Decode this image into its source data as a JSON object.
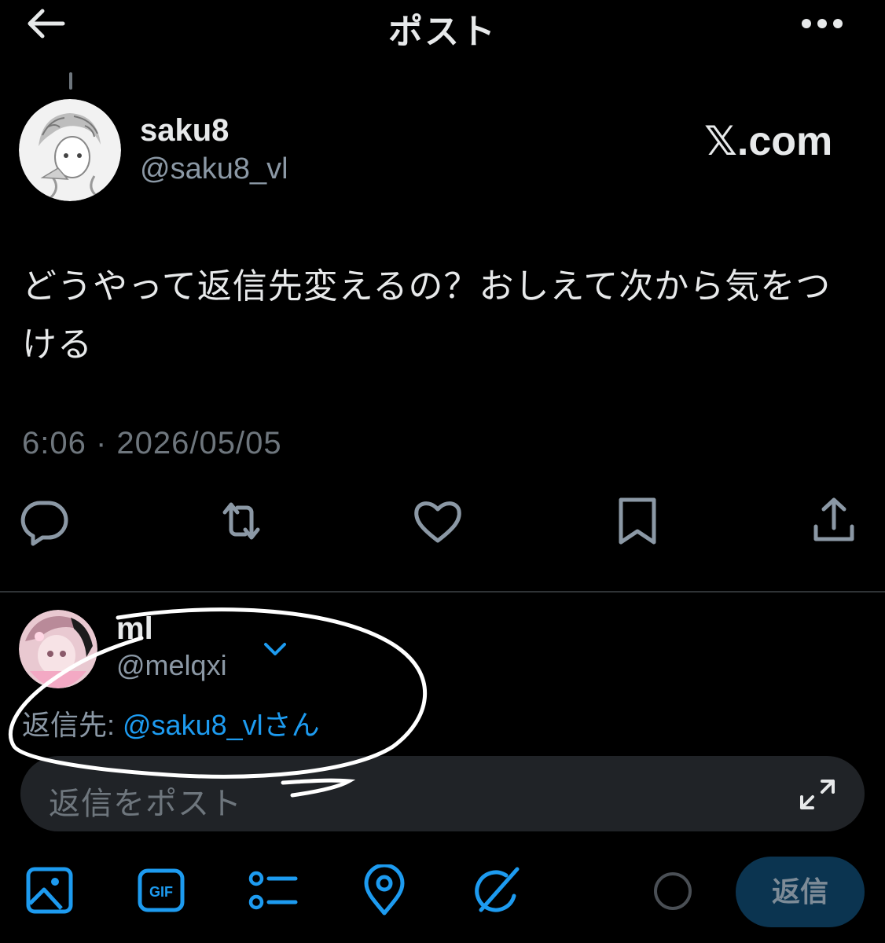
{
  "header": {
    "title": "ポスト",
    "back_icon": "arrow-left-icon",
    "more_icon": "more-horizontal-icon"
  },
  "post": {
    "author_name": "saku8",
    "author_handle": "@saku8_vl",
    "source_label": "𝕏.com",
    "text": "どうやって返信先変えるの？おしえて次から気をつける",
    "timestamp": "6:06 · 2026/05/05"
  },
  "actions": [
    "reply-icon",
    "repost-icon",
    "like-icon",
    "bookmark-icon",
    "share-icon"
  ],
  "reply": {
    "user_name": "ml",
    "user_handle": "@melqxi",
    "reply_to_label": "返信先: ",
    "reply_to_mention": "@saku8_vlさん",
    "placeholder": "返信をポスト"
  },
  "toolbar": {
    "icons": [
      "image-icon",
      "gif-icon",
      "poll-icon",
      "location-icon",
      "grok-icon"
    ],
    "reply_button": "返信"
  },
  "colors": {
    "background": "#000000",
    "accent": "#1d9bf0",
    "muted": "#8b98a5",
    "divider": "#2f3336",
    "reply_button_bg": "#0b3450"
  }
}
